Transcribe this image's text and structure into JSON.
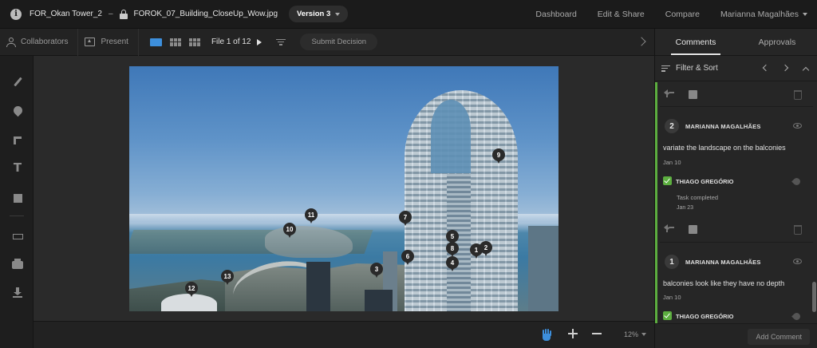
{
  "topbar": {
    "project": "FOR_Okan Tower_2",
    "separator": "–",
    "filename": "FOROK_07_Building_CloseUp_Wow.jpg",
    "version": "Version 3",
    "nav": [
      "Dashboard",
      "Edit & Share",
      "Compare"
    ],
    "user": "Marianna Magalhães"
  },
  "toolbar": {
    "collaborators": "Collaborators",
    "present": "Present",
    "file_counter": "File 1 of 12",
    "submit": "Submit Decision"
  },
  "markers": [
    "9",
    "11",
    "10",
    "7",
    "5",
    "8",
    "4",
    "1",
    "2",
    "6",
    "3",
    "13",
    "12"
  ],
  "canvas_bottom": {
    "zoom": "12%"
  },
  "panel": {
    "tabs": [
      "Comments",
      "Approvals"
    ],
    "filter_label": "Filter & Sort",
    "comments": [
      {
        "number": "2",
        "author": "MARIANNA MAGALHÃES",
        "text": "variate the landscape on the balconies",
        "date": "Jan 10",
        "reply_author": "THIAGO GREGÓRIO",
        "reply_text": "Task completed",
        "reply_date": "Jan 23"
      },
      {
        "number": "1",
        "author": "MARIANNA MAGALHÃES",
        "text": "balconies look like they have no depth",
        "date": "Jan 10",
        "reply_author": "THIAGO GREGÓRIO"
      }
    ],
    "add_comment": "Add Comment"
  },
  "colors": {
    "accent_blue": "#3d8fdc",
    "approval_green": "#5cae3f"
  }
}
